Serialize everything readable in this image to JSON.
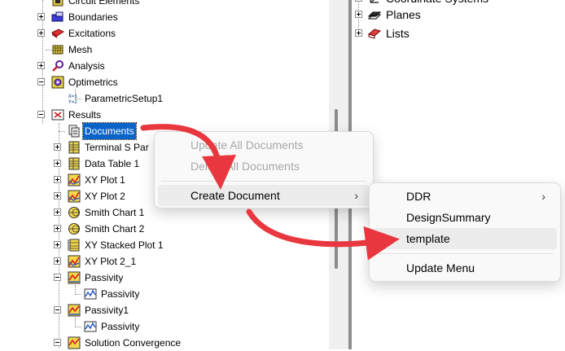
{
  "tree": {
    "items": [
      {
        "label": "Circuit Elements"
      },
      {
        "label": "Boundaries"
      },
      {
        "label": "Excitations"
      },
      {
        "label": "Mesh"
      },
      {
        "label": "Analysis"
      },
      {
        "label": "Optimetrics"
      },
      {
        "label": "ParametricSetup1"
      },
      {
        "label": "Results"
      },
      {
        "label": "Documents"
      },
      {
        "label": "Terminal S Par"
      },
      {
        "label": "Data Table 1"
      },
      {
        "label": "XY Plot 1"
      },
      {
        "label": "XY Plot 2"
      },
      {
        "label": "Smith Chart 1"
      },
      {
        "label": "Smith Chart 2"
      },
      {
        "label": "XY Stacked Plot 1"
      },
      {
        "label": "XY Plot 2_1"
      },
      {
        "label": "Passivity"
      },
      {
        "label": "Passivity"
      },
      {
        "label": "Passivity1"
      },
      {
        "label": "Passivity"
      },
      {
        "label": "Solution Convergence"
      }
    ]
  },
  "right_tree": {
    "items": [
      {
        "label": "Coordinate Systems"
      },
      {
        "label": "Planes"
      },
      {
        "label": "Lists"
      }
    ]
  },
  "context_menu": {
    "update_all": "Update All Documents",
    "delete_all": "Delete All Documents",
    "create_document": "Create Document"
  },
  "submenu": {
    "ddr": "DDR",
    "design_summary": "DesignSummary",
    "template": "template",
    "update_menu": "Update Menu"
  },
  "colors": {
    "selection": "#0a64c8",
    "annotation_arrow": "#e8373e",
    "menu_bg": "#f9f9f9",
    "splitter": "#8d8d8d"
  }
}
